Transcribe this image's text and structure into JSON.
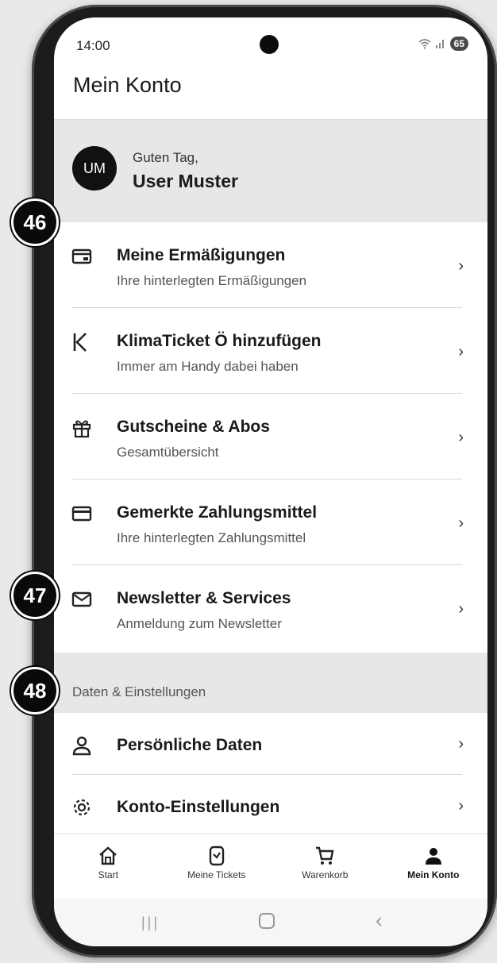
{
  "status_bar": {
    "time": "14:00",
    "battery": "65"
  },
  "header": {
    "title": "Mein Konto"
  },
  "greeting": {
    "avatar_initials": "UM",
    "salutation": "Guten Tag,",
    "name": "User Muster"
  },
  "menu": [
    {
      "title": "Meine Ermäßigungen",
      "subtitle": "Ihre hinterlegten Ermäßigungen",
      "icon": "discount-card-icon"
    },
    {
      "title": "KlimaTicket Ö hinzufügen",
      "subtitle": "Immer am Handy dabei haben",
      "icon": "klimaticket-k-icon"
    },
    {
      "title": "Gutscheine & Abos",
      "subtitle": "Gesamtübersicht",
      "icon": "gift-icon"
    },
    {
      "title": "Gemerkte Zahlungsmittel",
      "subtitle": "Ihre hinterlegten Zahlungsmittel",
      "icon": "credit-card-icon"
    },
    {
      "title": "Newsletter & Services",
      "subtitle": "Anmeldung zum Newsletter",
      "icon": "mail-icon"
    }
  ],
  "section_label": "Daten & Einstellungen",
  "settings": [
    {
      "title": "Persönliche Daten",
      "icon": "person-icon"
    },
    {
      "title": "Konto-Einstellungen",
      "icon": "gear-icon"
    }
  ],
  "bottom_nav": [
    {
      "label": "Start",
      "icon": "home-icon"
    },
    {
      "label": "Meine Tickets",
      "icon": "ticket-icon"
    },
    {
      "label": "Warenkorb",
      "icon": "cart-icon"
    },
    {
      "label": "Mein Konto",
      "icon": "account-icon",
      "active": true
    }
  ],
  "annotations": [
    "46",
    "47",
    "48"
  ],
  "colors": {
    "accent_dark": "#111111",
    "section_bg": "#e7e7ea"
  }
}
